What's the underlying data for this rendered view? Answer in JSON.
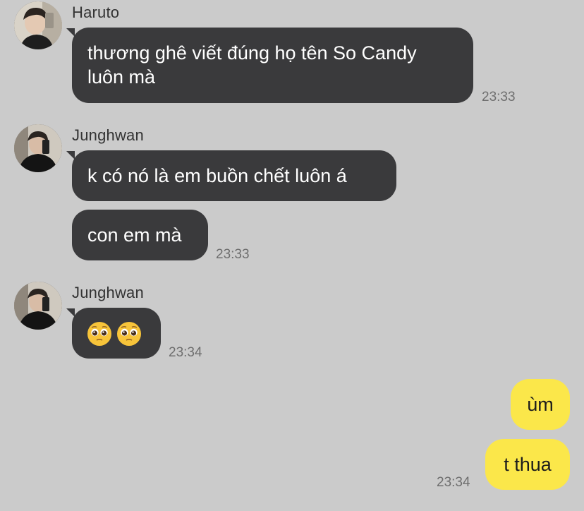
{
  "messages": [
    {
      "sender": "Haruto",
      "text": "thương ghê viết đúng họ tên So Candy luôn mà",
      "time": "23:33"
    },
    {
      "sender": "Junghwan",
      "text1": "k có nó là em buồn chết luôn á",
      "text2": "con em mà",
      "time": "23:33"
    },
    {
      "sender": "Junghwan",
      "emoji_names": [
        "pleading-face-emoji",
        "pleading-face-emoji"
      ],
      "time": "23:34"
    }
  ],
  "outgoing": {
    "text1": "ùm",
    "text2": "t thua",
    "time": "23:34"
  },
  "colors": {
    "background": "#cbcbcb",
    "incoming_bubble": "#3a3a3c",
    "outgoing_bubble": "#fbe74a"
  }
}
